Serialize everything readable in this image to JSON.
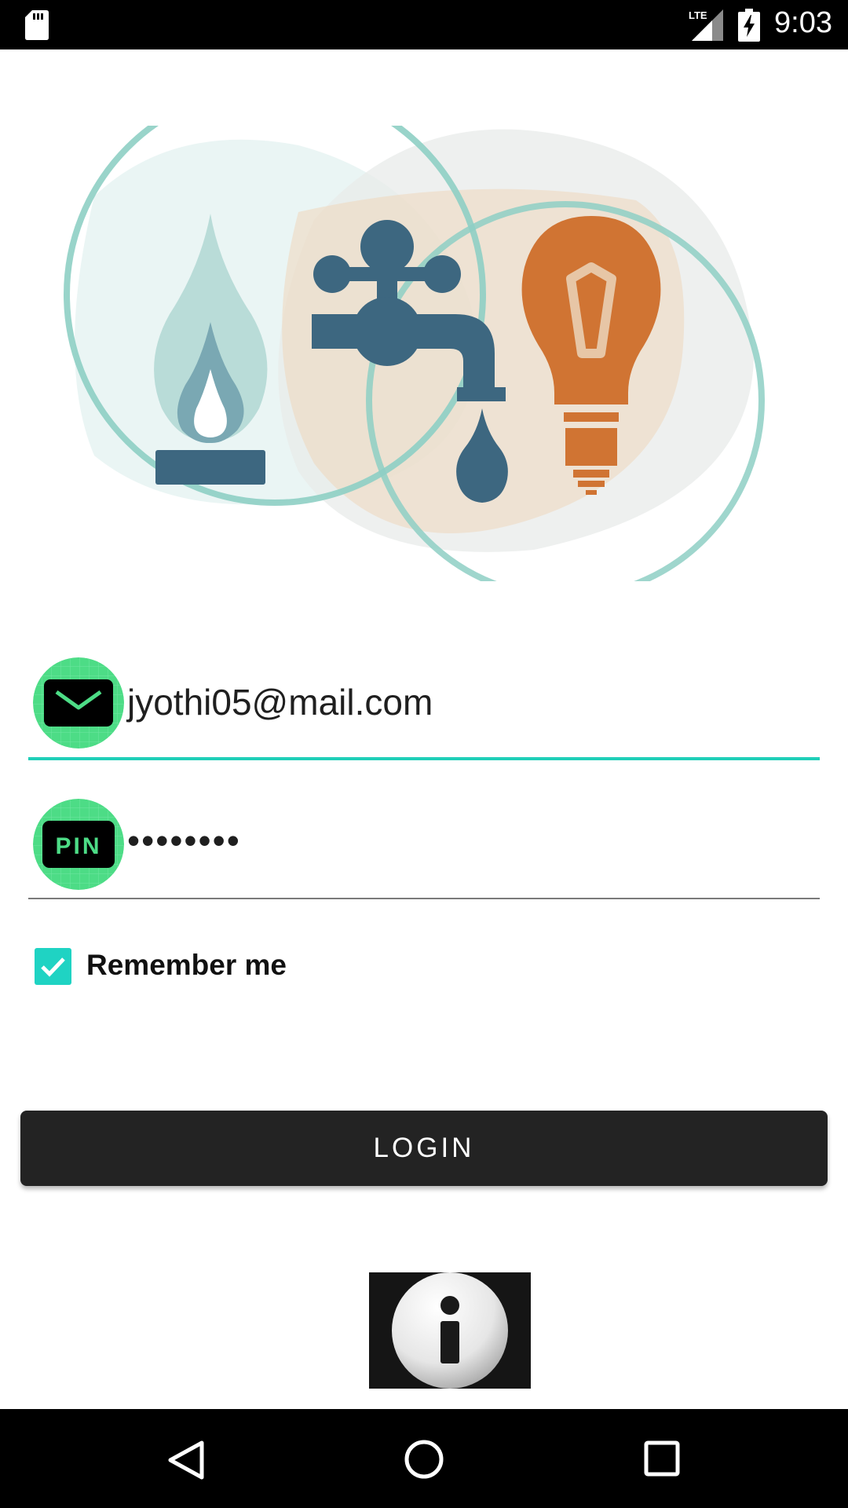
{
  "status_bar": {
    "time": "9:03",
    "network": "LTE",
    "icons": [
      "sd-card-icon",
      "lte-signal-icon",
      "battery-charging-icon"
    ]
  },
  "illustration": {
    "icons": [
      "gas-flame-icon",
      "water-tap-icon",
      "light-bulb-icon"
    ],
    "colors": {
      "flame": "#b9dcd8",
      "tap": "#3d6780",
      "bulb": "#d07433",
      "ring": "#8ecfc4"
    }
  },
  "login_form": {
    "email": {
      "value": "jyothi05@mail.com",
      "icon": "mail-icon"
    },
    "pin": {
      "value": "••••••••",
      "icon": "pin-icon",
      "badge_text": "PIN"
    },
    "remember_me": {
      "label": "Remember me",
      "checked": true
    },
    "login_label": "LOGIN"
  },
  "info": {
    "icon": "info-icon"
  },
  "nav_bar": {
    "icons": [
      "back-icon",
      "home-icon",
      "recent-apps-icon"
    ]
  },
  "colors": {
    "accent": "#1fcfb8",
    "badge_green": "#4ddc86",
    "button": "#232323"
  }
}
